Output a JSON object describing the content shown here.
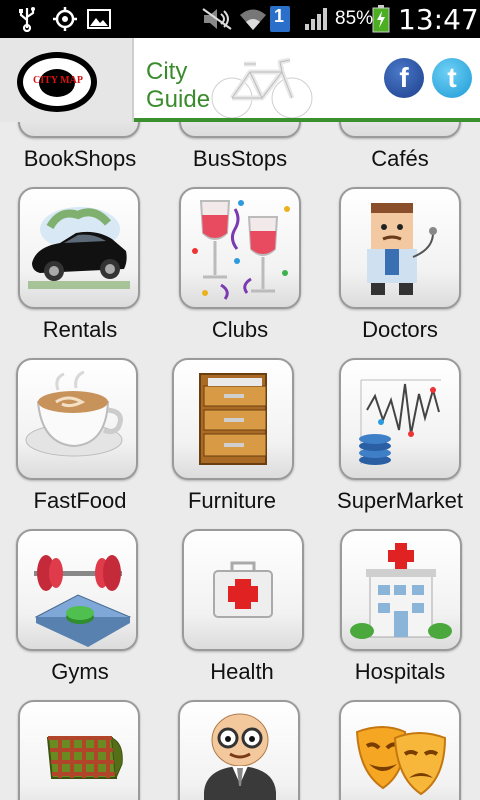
{
  "status_bar": {
    "battery": "85%",
    "time": "13:47",
    "notification_badge": "1",
    "icons": [
      "usb-icon",
      "gps-icon",
      "image-icon",
      "mute-icon",
      "wifi-icon",
      "signal-icon",
      "battery-icon"
    ]
  },
  "header": {
    "logo_text": "CITY MAP",
    "title_line1": "City",
    "title_line2": "Guide",
    "facebook_letter": "f",
    "twitter_letter": "t",
    "accent_color": "#3a8b2c"
  },
  "grid": {
    "items": [
      {
        "label": "BookShops",
        "icon": "bookshop-icon"
      },
      {
        "label": "BusStops",
        "icon": "busstop-icon"
      },
      {
        "label": "Cafés",
        "icon": "cafe-icon"
      },
      {
        "label": "Rentals",
        "icon": "car-icon"
      },
      {
        "label": "Clubs",
        "icon": "wine-glasses-icon"
      },
      {
        "label": "Doctors",
        "icon": "doctor-icon"
      },
      {
        "label": "FastFood",
        "icon": "coffee-cup-icon"
      },
      {
        "label": "Furniture",
        "icon": "cabinet-icon"
      },
      {
        "label": "SuperMarket",
        "icon": "market-chart-icon"
      },
      {
        "label": "Gyms",
        "icon": "barbell-icon"
      },
      {
        "label": "Health",
        "icon": "first-aid-kit-icon"
      },
      {
        "label": "Hospitals",
        "icon": "hospital-icon"
      },
      {
        "label": "",
        "icon": "fabric-icon"
      },
      {
        "label": "",
        "icon": "man-icon"
      },
      {
        "label": "",
        "icon": "theater-masks-icon"
      }
    ]
  }
}
